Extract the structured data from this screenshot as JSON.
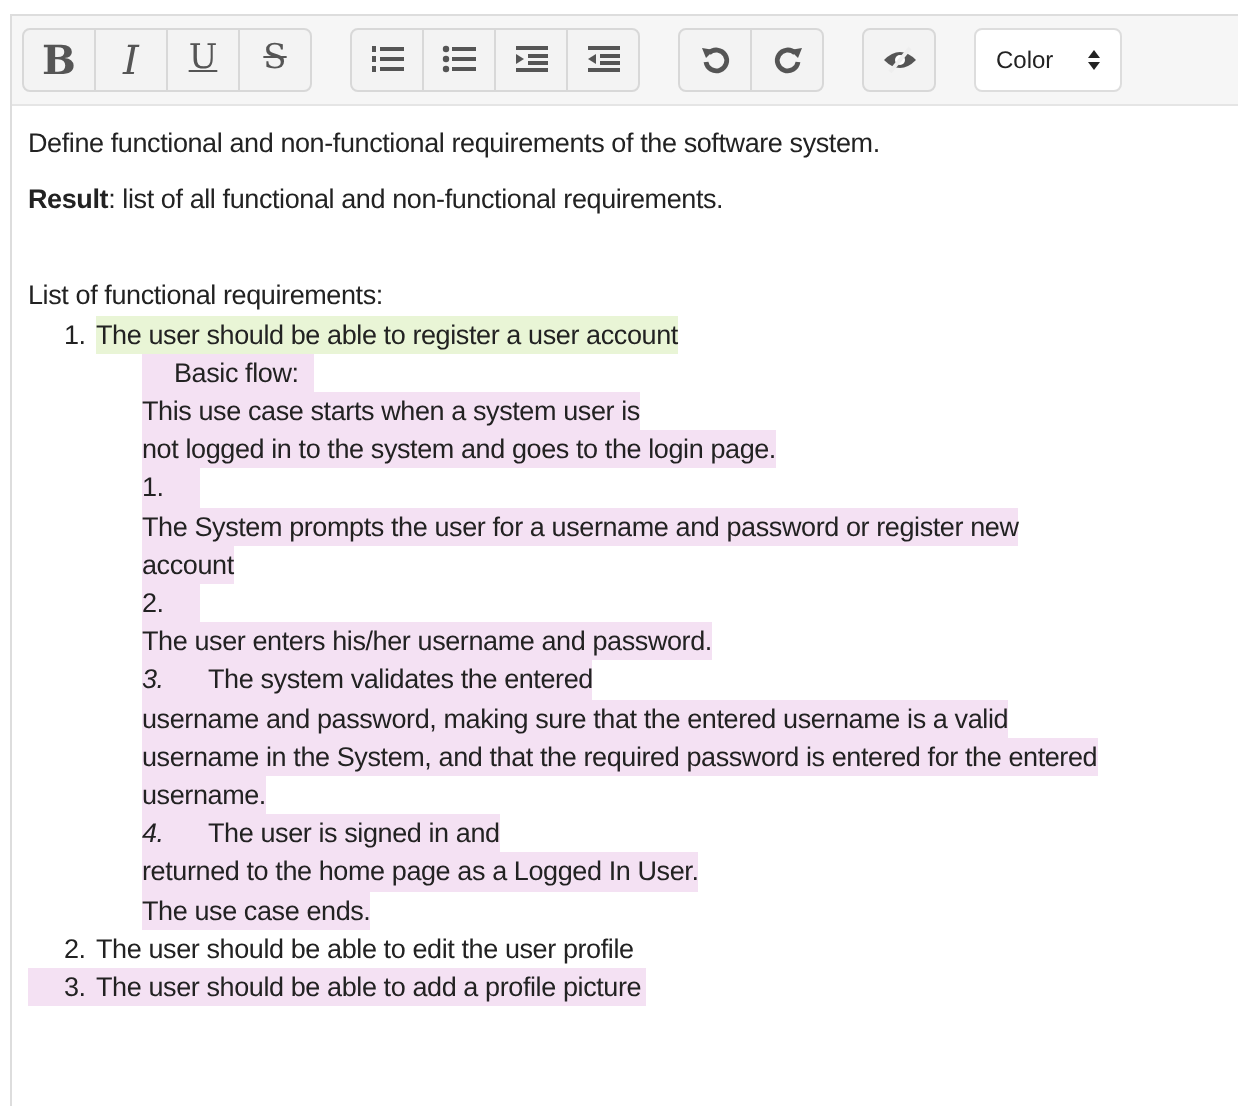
{
  "toolbar": {
    "groups": [
      {
        "buttons": [
          {
            "kind": "bold",
            "label": "B"
          },
          {
            "kind": "italic",
            "label": "I"
          },
          {
            "kind": "underline",
            "label": "U"
          },
          {
            "kind": "strike",
            "label": "S"
          }
        ]
      },
      {
        "buttons": [
          {
            "kind": "ordered-list"
          },
          {
            "kind": "bullet-list"
          },
          {
            "kind": "indent"
          },
          {
            "kind": "outdent"
          }
        ]
      },
      {
        "buttons": [
          {
            "kind": "undo"
          },
          {
            "kind": "redo"
          }
        ]
      },
      {
        "buttons": [
          {
            "kind": "hide"
          }
        ]
      }
    ],
    "color_select": {
      "label": "Color"
    }
  },
  "paragraphs": [
    "Define functional and non-functional requirements of the software system.",
    "**Result**: list of all functional and non-functional requirements."
  ],
  "list_title": "List of functional requirements:",
  "items": [
    {
      "marker": "1.",
      "text": "The user should be able to register a user account",
      "color": "#e9f5d6",
      "kind": "text-highlight",
      "details": {
        "color": "#f4e1f3",
        "lines": [
          {
            "kind": "heading",
            "text": "Basic flow:"
          },
          {
            "kind": "plain",
            "text": "This use case starts when a system user is"
          },
          {
            "kind": "plain",
            "text": "not logged in to the system and goes to the login page."
          },
          {
            "kind": "number",
            "text": "1."
          },
          {
            "kind": "plain",
            "text": "The System prompts the user for a username and password or register new"
          },
          {
            "kind": "plain",
            "text": "account"
          },
          {
            "kind": "number",
            "text": "2."
          },
          {
            "kind": "plain",
            "text": "The user enters his/her username and password."
          },
          {
            "kind": "step",
            "marker": "3.",
            "text": "The system validates the entered"
          },
          {
            "kind": "plain",
            "text": "username and password, making sure that the entered username is a valid"
          },
          {
            "kind": "plain",
            "text": "username in the System, and that the required password is entered for the entered"
          },
          {
            "kind": "plain",
            "text": "username."
          },
          {
            "kind": "step",
            "marker": "4.",
            "text": "The user is signed in and"
          },
          {
            "kind": "plain",
            "text": "returned to the home page as a Logged In User."
          },
          {
            "kind": "plain",
            "text": "The use case ends."
          }
        ]
      }
    },
    {
      "marker": "2.",
      "text": "The user should be able to edit the user profile"
    },
    {
      "marker": "3.",
      "text": "The user should be able to add a profile picture",
      "color": "#f4e1f3",
      "kind": "row-highlight"
    }
  ]
}
